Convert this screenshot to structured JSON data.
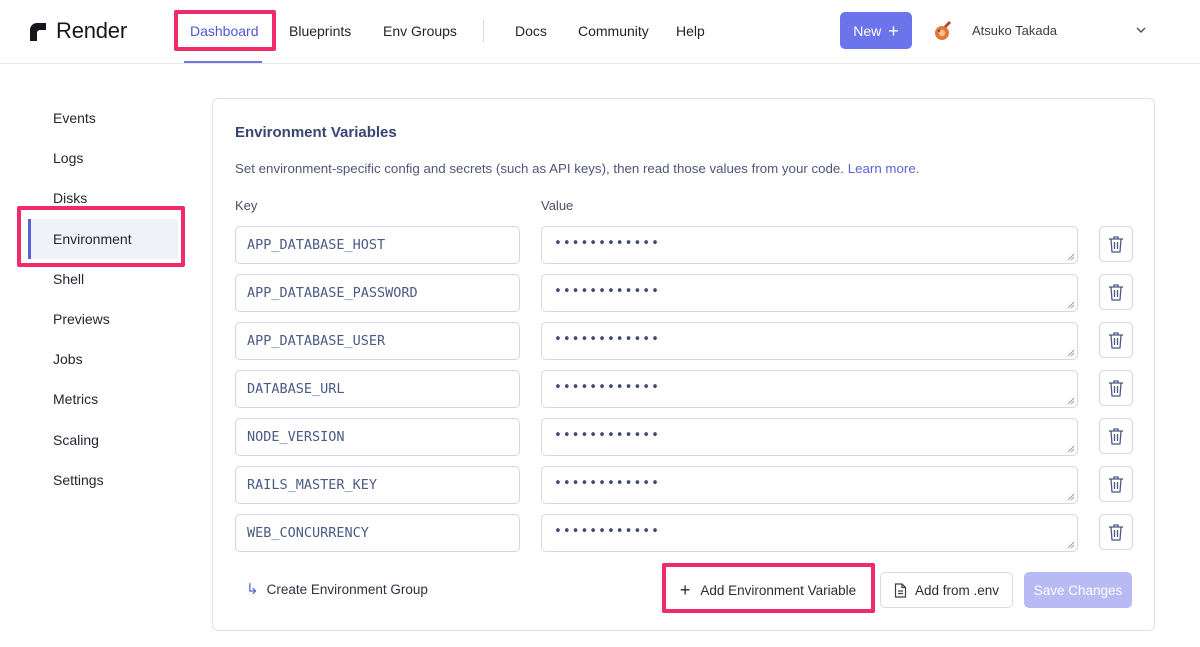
{
  "brand": {
    "name": "Render"
  },
  "nav": {
    "items": [
      {
        "label": "Dashboard",
        "active": true
      },
      {
        "label": "Blueprints"
      },
      {
        "label": "Env Groups"
      },
      {
        "label": "Docs"
      },
      {
        "label": "Community"
      },
      {
        "label": "Help"
      }
    ],
    "new_label": "New",
    "user_name": "Atsuko Takada"
  },
  "sidebar": {
    "items": [
      {
        "label": "Events"
      },
      {
        "label": "Logs"
      },
      {
        "label": "Disks"
      },
      {
        "label": "Environment",
        "active": true
      },
      {
        "label": "Shell"
      },
      {
        "label": "Previews"
      },
      {
        "label": "Jobs"
      },
      {
        "label": "Metrics"
      },
      {
        "label": "Scaling"
      },
      {
        "label": "Settings"
      }
    ]
  },
  "env": {
    "title": "Environment Variables",
    "description": "Set environment-specific config and secrets (such as API keys), then read those values from your code.",
    "learn_more": "Learn more.",
    "key_label": "Key",
    "value_label": "Value",
    "vars": [
      {
        "key": "APP_DATABASE_HOST",
        "value": "••••••••••••"
      },
      {
        "key": "APP_DATABASE_PASSWORD",
        "value": "••••••••••••"
      },
      {
        "key": "APP_DATABASE_USER",
        "value": "••••••••••••"
      },
      {
        "key": "DATABASE_URL",
        "value": "••••••••••••"
      },
      {
        "key": "NODE_VERSION",
        "value": "••••••••••••"
      },
      {
        "key": "RAILS_MASTER_KEY",
        "value": "••••••••••••"
      },
      {
        "key": "WEB_CONCURRENCY",
        "value": "••••••••••••"
      }
    ],
    "create_group_label": "Create Environment Group",
    "add_var_label": "Add Environment Variable",
    "add_from_env_label": "Add from .env",
    "save_label": "Save Changes"
  },
  "colors": {
    "accent": "#5b63db",
    "highlight": "#ef2b6a",
    "new_button": "#6b74ea",
    "save_disabled": "#b8bbf3"
  }
}
